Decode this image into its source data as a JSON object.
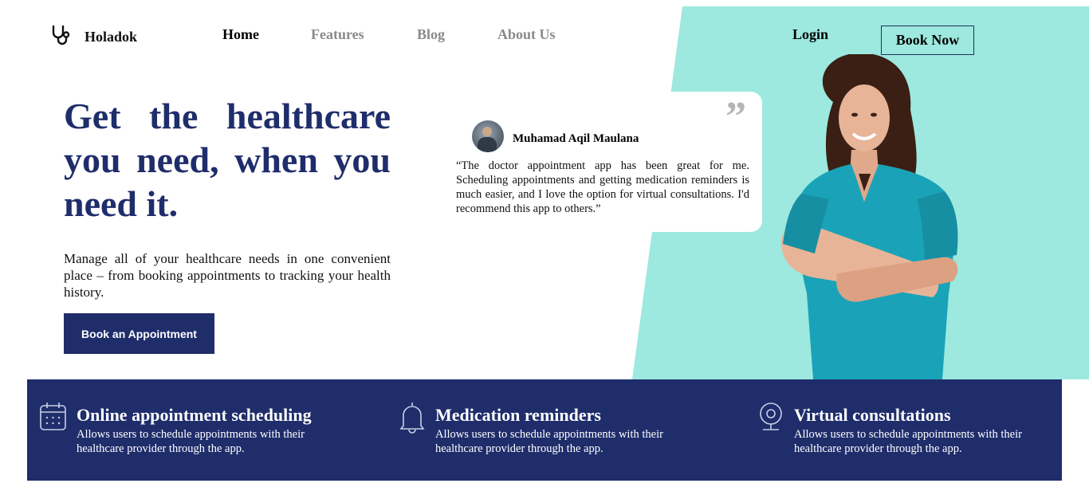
{
  "brand": {
    "name": "Holadok",
    "icon": "stethoscope-icon"
  },
  "nav": {
    "items": [
      {
        "label": "Home",
        "active": true
      },
      {
        "label": "Features",
        "active": false
      },
      {
        "label": "Blog",
        "active": false
      },
      {
        "label": "About Us",
        "active": false
      }
    ],
    "login_label": "Login",
    "book_now_label": "Book Now"
  },
  "hero": {
    "title": "Get the healthcare you need, when you need it.",
    "description": "Manage all of your healthcare needs in one convenient place – from booking appointments to tracking your health history.",
    "cta_label": "Book an Appointment"
  },
  "testimonial": {
    "quote_glyph": "”",
    "author": "Muhamad Aqil Maulana",
    "text": "“The doctor appointment app has been great for me. Scheduling appointments and getting medication reminders is much easier, and I love the option for virtual consultations. I'd recommend this app to others.”"
  },
  "features": [
    {
      "icon": "calendar-icon",
      "title": "Online appointment scheduling",
      "description": "Allows users to schedule appointments with their healthcare provider through the app."
    },
    {
      "icon": "bell-icon",
      "title": "Medication reminders",
      "description": "Allows users to schedule appointments with their healthcare provider through the app."
    },
    {
      "icon": "webcam-icon",
      "title": "Virtual consultations",
      "description": "Allows users to schedule appointments with their healthcare provider through the app."
    }
  ],
  "colors": {
    "primary": "#1f2d6b",
    "accent_teal": "#9de9df",
    "nav_inactive": "#8a8a8a",
    "scrubs": "#1aa3b8"
  }
}
